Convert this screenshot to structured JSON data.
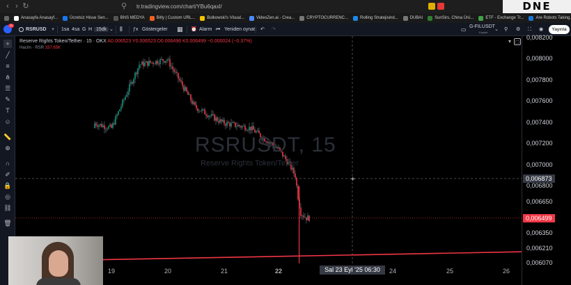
{
  "browser": {
    "url": "tr.tradingview.com/chart/YBu6qaxl/",
    "corner_logo": "DNE"
  },
  "bookmarks": [
    {
      "label": "Anasayfa Anasayf...",
      "color": "#ffffff"
    },
    {
      "label": "Ücretsiz Hisse Sen...",
      "color": "#1877f2"
    },
    {
      "label": "BNS MEDYA",
      "color": "#555555"
    },
    {
      "label": "Bitly | Custom URL...",
      "color": "#ee6123"
    },
    {
      "label": "Bulkowski's Visual...",
      "color": "#f2c200"
    },
    {
      "label": "VideoZen.ai - Crea...",
      "color": "#4a8cff"
    },
    {
      "label": "CRYPTOCURRENC...",
      "color": "#777777"
    },
    {
      "label": "Rolling Stratejisind...",
      "color": "#1e88e5"
    },
    {
      "label": "DUBAI",
      "color": "#777777"
    },
    {
      "label": "SunSirs, China Ürü...",
      "color": "#2e7d32"
    },
    {
      "label": "ETF - Exchange Tr...",
      "color": "#43a047"
    },
    {
      "label": "Are Robots Taking...",
      "color": "#1976d2"
    }
  ],
  "toolbar": {
    "avatar_badge": "11",
    "symbol": "RSRUSD",
    "timeframes": [
      "1sa",
      "4sa",
      "G",
      "H",
      "15dk"
    ],
    "active_timeframe": "15dk",
    "indicators_label": "Göstergeler",
    "alarm_label": "Alarm",
    "replay_label": "Yeniden oynat",
    "layout_name": "G-FILUSDT",
    "layout_sub": "Kaydet",
    "publish_label": "Yayınla"
  },
  "legend": {
    "title": "Reserve Rights Token/Tether · 15 · OKX",
    "ohlc": "A0.006523 Y0.006523 D0.006496 K0.006499 −0.000024 (−0.37%)",
    "volume_label": "Hacim · RSR",
    "volume_value": "337.65K"
  },
  "watermark": {
    "symbol": "RSRUSDT, 15",
    "name": "Reserve Rights Token/Tether"
  },
  "price_axis": {
    "labels": [
      "0,008200",
      "0,008000",
      "0,007800",
      "0,007600",
      "0,007400",
      "0,007200",
      "0,007000",
      "0,006800",
      "0,006650",
      "0,006350",
      "0,006210",
      "0,006070"
    ],
    "crosshair_price": "0,006873",
    "last_price": "0,006499"
  },
  "time_axis": {
    "labels": [
      "19",
      "20",
      "21",
      "22",
      "24",
      "25",
      "26"
    ],
    "crosshair_time": "Sal 23 Eyl '25   06:30"
  },
  "chart_data": {
    "type": "line",
    "title": "Reserve Rights Token/Tether · 15 · OKX",
    "xlabel": "",
    "ylabel": "",
    "x": [
      "19",
      "19.5",
      "20",
      "20.5",
      "21",
      "21.5",
      "22",
      "22.2",
      "22.3",
      "22.35",
      "22.4",
      "22.5"
    ],
    "series": [
      {
        "name": "RSRUSDT",
        "values": [
          0.00735,
          0.00795,
          0.008,
          0.00755,
          0.0074,
          0.00735,
          0.00715,
          0.007,
          0.0069,
          0.0067,
          0.00655,
          0.0065
        ]
      }
    ],
    "ylim": [
      0.00605,
      0.00822
    ],
    "support_line": {
      "from": 0.00609,
      "to": 0.00618
    },
    "grid": false,
    "colors": {
      "up": "#089981",
      "down": "#f23645",
      "wick": "#6b6f7a",
      "support": "#f23645"
    }
  }
}
